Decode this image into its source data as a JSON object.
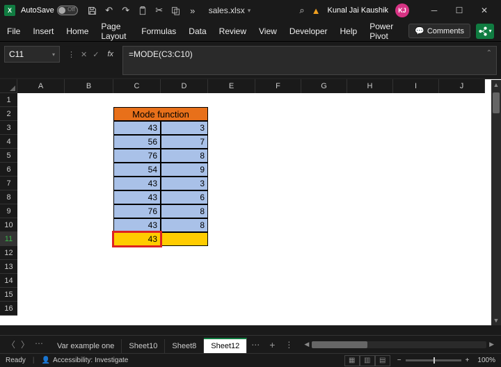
{
  "title_bar": {
    "autosave_label": "AutoSave",
    "autosave_state": "Off",
    "filename": "sales.xlsx",
    "user_name": "Kunal Jai Kaushik",
    "user_initials": "KJ"
  },
  "ribbon": {
    "tabs": [
      "File",
      "Insert",
      "Home",
      "Page Layout",
      "Formulas",
      "Data",
      "Review",
      "View",
      "Developer",
      "Help",
      "Power Pivot"
    ],
    "comments_label": "Comments"
  },
  "formula_bar": {
    "cell_ref": "C11",
    "formula": "=MODE(C3:C10)"
  },
  "columns": [
    {
      "label": "A",
      "width": 68
    },
    {
      "label": "B",
      "width": 70
    },
    {
      "label": "C",
      "width": 68
    },
    {
      "label": "D",
      "width": 68
    },
    {
      "label": "E",
      "width": 68
    },
    {
      "label": "F",
      "width": 66
    },
    {
      "label": "G",
      "width": 66
    },
    {
      "label": "H",
      "width": 66
    },
    {
      "label": "I",
      "width": 66
    },
    {
      "label": "J",
      "width": 66
    }
  ],
  "row_count": 16,
  "selected_row": 11,
  "sheet_data": {
    "header": {
      "row": 2,
      "text": "Mode function",
      "span_cols": [
        "C",
        "D"
      ]
    },
    "data_rows": [
      {
        "row": 3,
        "c": 43,
        "d": 3
      },
      {
        "row": 4,
        "c": 56,
        "d": 7
      },
      {
        "row": 5,
        "c": 76,
        "d": 8
      },
      {
        "row": 6,
        "c": 54,
        "d": 9
      },
      {
        "row": 7,
        "c": 43,
        "d": 3
      },
      {
        "row": 8,
        "c": 43,
        "d": 6
      },
      {
        "row": 9,
        "c": 76,
        "d": 8
      },
      {
        "row": 10,
        "c": 43,
        "d": 8
      }
    ],
    "result_row": {
      "row": 11,
      "c": 43,
      "d": ""
    }
  },
  "sheet_tabs": {
    "tabs": [
      "Var example one",
      "Sheet10",
      "Sheet8",
      "Sheet12"
    ],
    "active": "Sheet12"
  },
  "status_bar": {
    "mode": "Ready",
    "accessibility": "Accessibility: Investigate",
    "zoom": "100%"
  }
}
